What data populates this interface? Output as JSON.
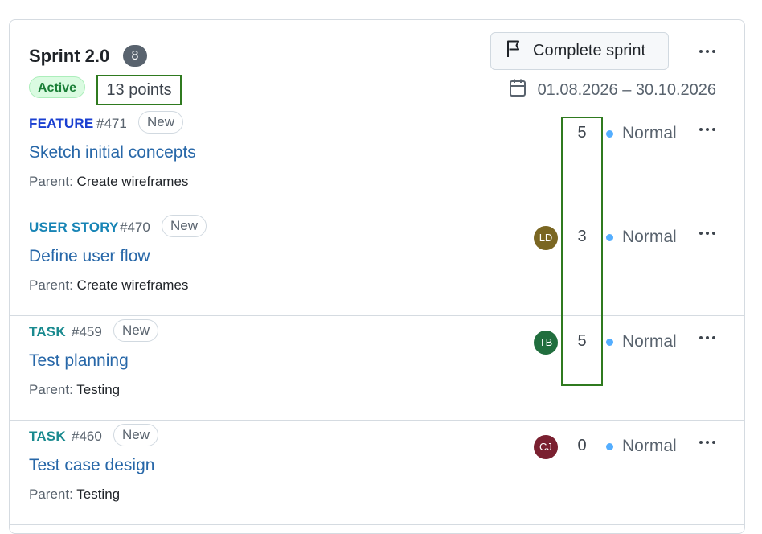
{
  "sprint": {
    "title": "Sprint 2.0",
    "item_count": "8",
    "status": "Active",
    "points": "13 points",
    "complete_label": "Complete sprint",
    "date_range": "01.08.2026 – 30.10.2026"
  },
  "items": [
    {
      "type": "FEATURE",
      "type_color": "#1a3fd1",
      "number": "#471",
      "state": "New",
      "title": "Sketch initial concepts",
      "parent_label": "Parent:",
      "parent": "Create wireframes",
      "assignee": "",
      "assignee_color": "",
      "estimate": "5",
      "priority": "Normal"
    },
    {
      "type": "USER STORY",
      "type_color": "#1784b5",
      "number": "#470",
      "state": "New",
      "title": "Define user flow",
      "parent_label": "Parent:",
      "parent": "Create wireframes",
      "assignee": "LD",
      "assignee_color": "#7a6622",
      "estimate": "3",
      "priority": "Normal"
    },
    {
      "type": "TASK",
      "type_color": "#1a8a8f",
      "number": "#459",
      "state": "New",
      "title": "Test planning",
      "parent_label": "Parent:",
      "parent": "Testing",
      "assignee": "TB",
      "assignee_color": "#216e3e",
      "estimate": "5",
      "priority": "Normal"
    },
    {
      "type": "TASK",
      "type_color": "#1a8a8f",
      "number": "#460",
      "state": "New",
      "title": "Test case design",
      "parent_label": "Parent:",
      "parent": "Testing",
      "assignee": "CJ",
      "assignee_color": "#7a2030",
      "estimate": "0",
      "priority": "Normal"
    }
  ],
  "icons": {
    "flag": "flag-icon",
    "calendar": "calendar-icon",
    "more": "kebab-horizontal-icon",
    "priority_dot": "priority-dot-icon"
  },
  "colors": {
    "active_green": "#1a7f37",
    "highlight": "#2f7a1f",
    "priority_blue": "#54aeff"
  }
}
